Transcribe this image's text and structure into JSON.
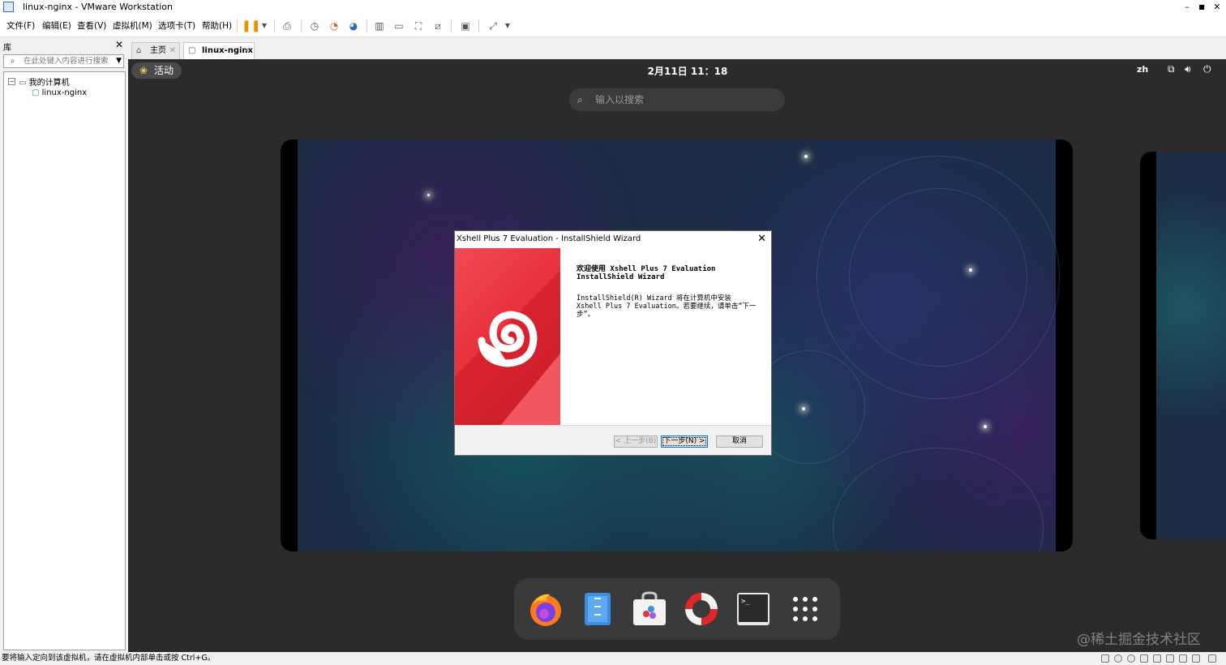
{
  "window": {
    "title": "linux-nginx - VMware Workstation",
    "minimize": "–",
    "maximize": "■",
    "close": "✕"
  },
  "menu": [
    "文件(F)",
    "编辑(E)",
    "查看(V)",
    "虚拟机(M)",
    "选项卡(T)",
    "帮助(H)"
  ],
  "library": {
    "header": "库",
    "close": "✕",
    "search_placeholder": "在此处键入内容进行搜索",
    "root": "我的计算机",
    "vm": "linux-nginx"
  },
  "tabs": [
    {
      "label": "主页",
      "close": "✕"
    },
    {
      "label": "linux-nginx",
      "close": "✕"
    }
  ],
  "gnome": {
    "activities": "活动",
    "clock": "2月11日 11：18",
    "lang": "zh",
    "search_placeholder": "输入以搜索"
  },
  "dialog": {
    "title": "Xshell Plus 7 Evaluation - InstallShield Wizard",
    "close": "✕",
    "heading": "欢迎使用 Xshell Plus 7 Evaluation\nInstallShield Wizard",
    "body": "InstallShield(R) Wizard 将在计算机中安装 Xshell Plus 7 Evaluation。若要继续，请单击“下一步”。",
    "back": "< 上一步(B)",
    "next": "下一步(N) >",
    "cancel": "取消"
  },
  "dock": [
    "firefox-icon",
    "files-icon",
    "software-icon",
    "help-icon",
    "terminal-icon",
    "app-grid-icon"
  ],
  "watermark": "@稀土掘金技术社区",
  "statusbar": {
    "text": "要将输入定向到该虚拟机，请在虚拟机内部单击或按 Ctrl+G。"
  },
  "colors": {
    "accent_red": "#e8313c",
    "vm_bg": "#2b2b2b",
    "pause_orange": "#f08c00"
  }
}
